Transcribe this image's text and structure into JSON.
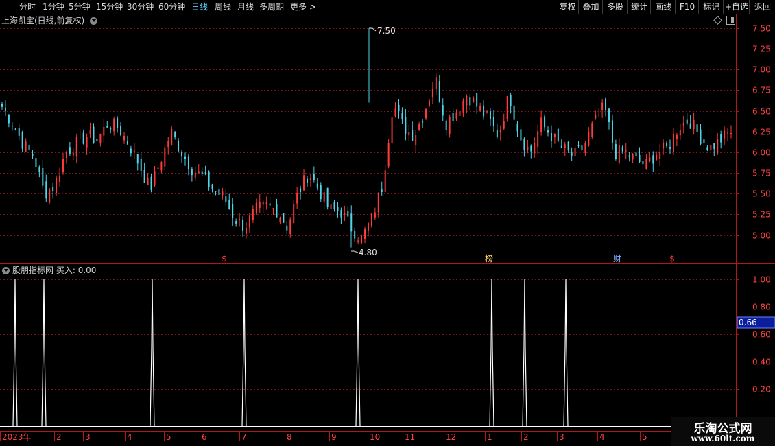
{
  "toolbar": {
    "periods": [
      "分时",
      "1分钟",
      "5分钟",
      "15分钟",
      "30分钟",
      "60分钟",
      "日线",
      "周线",
      "月线",
      "多周期",
      "更多 >"
    ],
    "active": "日线",
    "right": [
      "复权",
      "叠加",
      "多股",
      "统计",
      "画线",
      "F10",
      "标记",
      "+自选",
      "返回"
    ]
  },
  "stock": {
    "title": "上海凯宝(日线,前复权)"
  },
  "price_axis": {
    "labels": [
      "7.50",
      "7.25",
      "7.00",
      "6.75",
      "6.50",
      "6.25",
      "6.00",
      "5.75",
      "5.50",
      "5.25",
      "5.00"
    ]
  },
  "annotations": {
    "high": "7.50",
    "low": "4.80"
  },
  "markers": [
    {
      "label": "$",
      "color": "#ff3b3b"
    },
    {
      "label": "榜",
      "color": "#ffd36b"
    },
    {
      "label": "财",
      "color": "#7fb6ff"
    },
    {
      "label": "$",
      "color": "#ff3b3b"
    }
  ],
  "indicator": {
    "name": "股朋指标网",
    "series_label": "买入",
    "value": "0.00",
    "axis_labels": [
      "1.00",
      "0.80",
      "0.60",
      "0.40",
      "0.20"
    ],
    "current": "0.66"
  },
  "date_axis": {
    "labels": [
      "2023年",
      "2",
      "3",
      "4",
      "5",
      "6",
      "7",
      "8",
      "9",
      "10",
      "11",
      "12",
      "1",
      "2",
      "3",
      "4",
      "5"
    ]
  },
  "watermark": {
    "title": "乐淘公式网",
    "url": "www.60lt.com"
  },
  "colors": {
    "up": "#ff3b3b",
    "down": "#4fd5e8",
    "grid": "#7a1515",
    "border": "#b01818",
    "spike": "#ffffff"
  },
  "chart_data": {
    "type": "candlestick",
    "title": "上海凯宝(日线,前复权)",
    "ylim": [
      4.8,
      7.5
    ],
    "y_ticks": [
      5.0,
      5.25,
      5.5,
      5.75,
      6.0,
      6.25,
      6.5,
      6.75,
      7.0,
      7.25,
      7.5
    ],
    "highest": 7.5,
    "lowest": 4.8,
    "x_labels": [
      "2023年",
      "2",
      "3",
      "4",
      "5",
      "6",
      "7",
      "8",
      "9",
      "10",
      "11",
      "12",
      "1",
      "2",
      "3",
      "4",
      "5"
    ],
    "close_trend": [
      6.55,
      6.35,
      6.1,
      5.95,
      5.5,
      5.6,
      6.0,
      6.1,
      6.2,
      6.15,
      6.35,
      6.3,
      6.1,
      5.85,
      5.55,
      5.9,
      6.25,
      6.0,
      5.8,
      5.7,
      5.55,
      5.45,
      5.2,
      5.1,
      5.3,
      5.35,
      5.3,
      5.1,
      5.5,
      5.75,
      5.55,
      5.3,
      5.3,
      5.1,
      4.95,
      5.2,
      5.6,
      6.6,
      6.3,
      6.2,
      6.5,
      6.9,
      6.35,
      6.5,
      6.7,
      6.55,
      6.4,
      6.2,
      6.7,
      6.2,
      6.0,
      6.35,
      6.2,
      6.05,
      5.95,
      6.05,
      6.35,
      6.55,
      6.0,
      6.0,
      5.9,
      5.85,
      6.0,
      6.05,
      6.3,
      6.4,
      6.2,
      6.05,
      6.15,
      6.25
    ],
    "signal_series": {
      "name": "买入",
      "type": "spike",
      "spike_value": 1.0,
      "spike_positions": [
        "2023-01",
        "2023-02",
        "2023-05",
        "2023-07",
        "2023-10",
        "2024-01",
        "2024-03"
      ]
    }
  }
}
